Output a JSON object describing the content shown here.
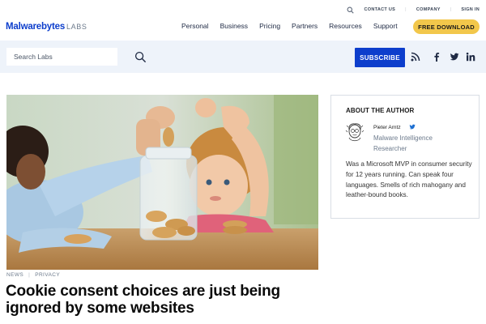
{
  "header": {
    "logo_brand": "Malwarebytes",
    "logo_suffix": "LABS",
    "top_links": [
      "CONTACT US",
      "COMPANY",
      "SIGN IN"
    ],
    "nav": [
      "Personal",
      "Business",
      "Pricing",
      "Partners",
      "Resources",
      "Support"
    ],
    "download_label": "FREE DOWNLOAD"
  },
  "search": {
    "placeholder": "Search Labs",
    "value": ""
  },
  "subscribe_label": "SUBSCRIBE",
  "social_icons": [
    "rss-icon",
    "facebook-icon",
    "twitter-icon",
    "linkedin-icon"
  ],
  "article": {
    "category": "NEWS",
    "subcategory": "PRIVACY",
    "title": "Cookie consent choices are just being ignored by some websites"
  },
  "author": {
    "heading": "ABOUT THE AUTHOR",
    "name": "Pieter Arntz",
    "role": "Malware Intelligence Researcher",
    "bio": "Was a Microsoft MVP in consumer security for 12 years running. Can speak four languages. Smells of rich mahogany and leather-bound books."
  },
  "colors": {
    "brand_blue": "#0d3ecc",
    "download_yellow": "#f2c74b",
    "search_band": "#eef3fa"
  }
}
